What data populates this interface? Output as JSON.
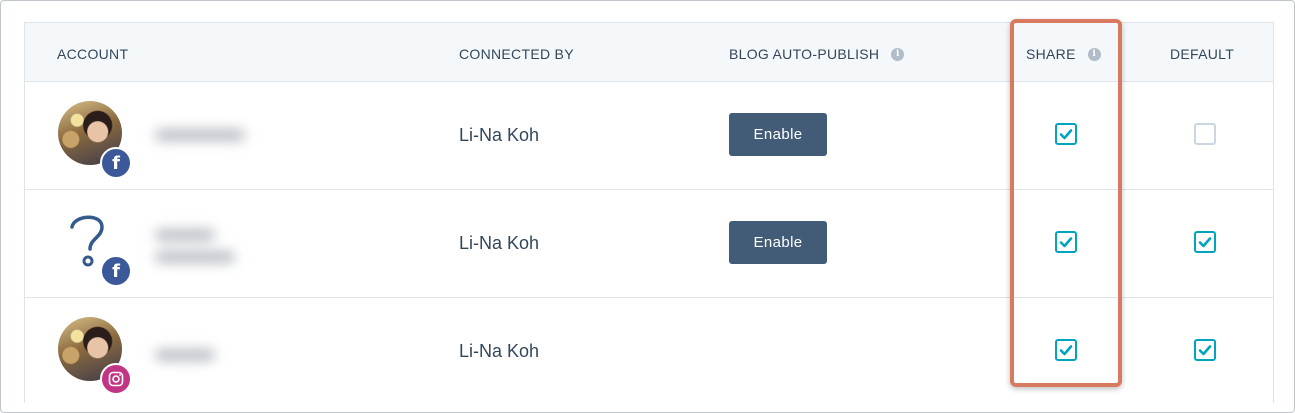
{
  "table": {
    "headers": {
      "account": "ACCOUNT",
      "connected_by": "CONNECTED BY",
      "blog_auto_publish": "BLOG AUTO-PUBLISH",
      "share": "SHARE",
      "default": "DEFAULT"
    },
    "rows": [
      {
        "avatar": "profile-photo",
        "network": "facebook",
        "network_icon_glyph": "f",
        "connected_by": "Li-Na Koh",
        "blog_auto_publish_label": "Enable",
        "share_checked": true,
        "default_checked": false
      },
      {
        "avatar": "question-mark-image",
        "network": "facebook",
        "network_icon_glyph": "f",
        "connected_by": "Li-Na Koh",
        "blog_auto_publish_label": "Enable",
        "share_checked": true,
        "default_checked": true
      },
      {
        "avatar": "profile-photo",
        "network": "instagram",
        "network_icon_glyph": "",
        "connected_by": "Li-Na Koh",
        "share_checked": true,
        "default_checked": true
      }
    ]
  },
  "colors": {
    "header_bg": "#f5f8fa",
    "text": "#33475b",
    "button_bg": "#425b76",
    "checkbox_checked": "#00a4bd",
    "highlight_border": "#d87a5f",
    "facebook": "#3b5998",
    "instagram": "#c13584"
  }
}
